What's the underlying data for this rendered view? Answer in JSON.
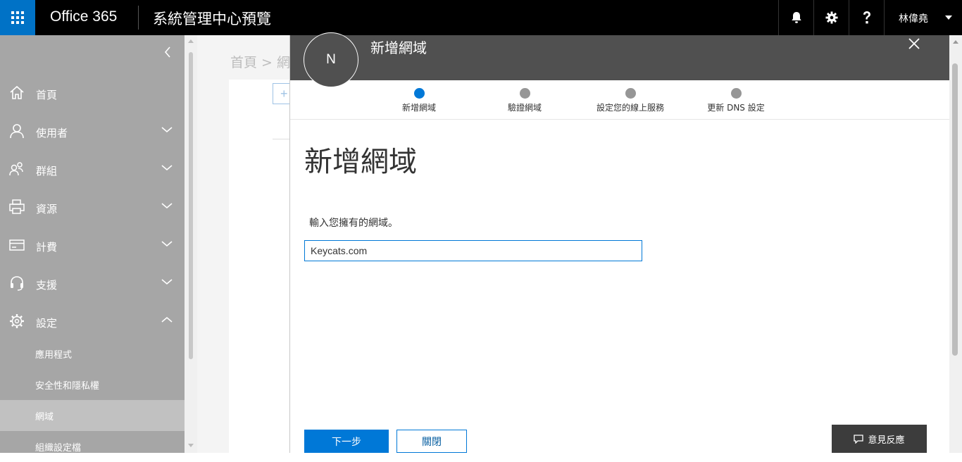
{
  "topbar": {
    "app_name": "Office 365",
    "page_title": "系統管理中心預覽",
    "user_name": "林偉堯"
  },
  "sidebar": {
    "items": [
      {
        "label": "首頁",
        "icon": "home-icon"
      },
      {
        "label": "使用者",
        "icon": "user-icon"
      },
      {
        "label": "群組",
        "icon": "group-icon"
      },
      {
        "label": "資源",
        "icon": "printer-icon"
      },
      {
        "label": "計費",
        "icon": "credit-card-icon"
      },
      {
        "label": "支援",
        "icon": "headset-icon"
      },
      {
        "label": "設定",
        "icon": "gear-icon"
      }
    ],
    "sub_items": [
      {
        "label": "應用程式"
      },
      {
        "label": "安全性和隱私權"
      },
      {
        "label": "網域",
        "active": true
      },
      {
        "label": "組織設定檔"
      }
    ]
  },
  "background_page": {
    "breadcrumb": "首頁 > 網域",
    "button_label": "+"
  },
  "panel": {
    "title": "新增網域",
    "avatar_initial": "N",
    "steps": [
      {
        "label": "新增網域",
        "active": true
      },
      {
        "label": "驗證網域",
        "active": false
      },
      {
        "label": "設定您的線上服務",
        "active": false
      },
      {
        "label": "更新 DNS 設定",
        "active": false
      }
    ],
    "heading": "新增網域",
    "instructions": "輸入您擁有的網域。",
    "domain_value": "Keycats.com",
    "next_label": "下一步",
    "close_label": "關閉"
  },
  "feedback": {
    "label": "意見反應"
  },
  "colors": {
    "accent": "#0078d7",
    "waffle": "#0072c6",
    "sidebar": "#a6a6a6",
    "panel_header": "#505050"
  }
}
